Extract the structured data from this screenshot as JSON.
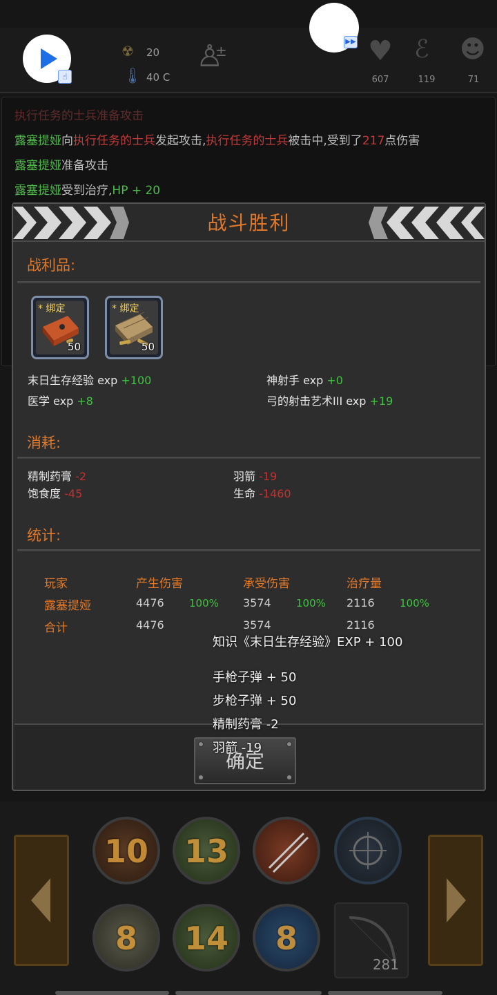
{
  "hud": {
    "radiation": "20",
    "temperature": "40 C",
    "health": "607",
    "hunger": "119",
    "mind": "71"
  },
  "log": {
    "line0": "执行任务的士兵准备攻击",
    "line1": {
      "actor": "露塞提娅",
      "t1": "向",
      "target": "执行任务的士兵",
      "t2": "发起攻击,",
      "target2": "执行任务的士兵",
      "t3": "被击中,受到了",
      "damage": "217",
      "t4": "点伤害"
    },
    "line2": {
      "actor": "露塞提娅",
      "text": "准备攻击"
    },
    "line3": {
      "actor": "露塞提娅",
      "text": "受到治疗,",
      "hp": "HP + 20"
    }
  },
  "panel": {
    "title": "战斗胜利",
    "loot_title": "战利品:",
    "items": [
      {
        "bound": "* 绑定",
        "count": "50"
      },
      {
        "bound": "* 绑定",
        "count": "50"
      }
    ],
    "exp": [
      {
        "label": "末日生存经验 exp",
        "value": "+100"
      },
      {
        "label": "神射手 exp",
        "value": "+0"
      },
      {
        "label": "医学 exp",
        "value": "+8"
      },
      {
        "label": "弓的射击艺术III exp",
        "value": "+19"
      }
    ],
    "consume_title": "消耗:",
    "consume": [
      {
        "label": "精制药膏",
        "value": "-2"
      },
      {
        "label": "羽箭",
        "value": "-19"
      },
      {
        "label": "饱食度",
        "value": "-45"
      },
      {
        "label": "生命",
        "value": "-1460"
      }
    ],
    "stats_title": "统计:",
    "stats_headers": [
      "玩家",
      "产生伤害",
      "承受伤害",
      "治疗量"
    ],
    "stats_rows": [
      {
        "name": "露塞提娅",
        "dmg": "4476",
        "dmg_pct": "100%",
        "taken": "3574",
        "taken_pct": "100%",
        "heal": "2116",
        "heal_pct": "100%"
      },
      {
        "name": "合计",
        "dmg": "4476",
        "taken": "3574",
        "heal": "2116"
      }
    ],
    "confirm": "确定"
  },
  "toast": [
    "知识《末日生存经验》EXP + 100",
    "手枪子弹 + 50",
    "步枪子弹 + 50",
    "精制药膏 -2",
    "羽箭 -19"
  ],
  "skills": {
    "top": [
      "10",
      "13",
      "",
      ""
    ],
    "bottom": [
      "8",
      "14",
      "8"
    ],
    "bow_count": "281"
  }
}
